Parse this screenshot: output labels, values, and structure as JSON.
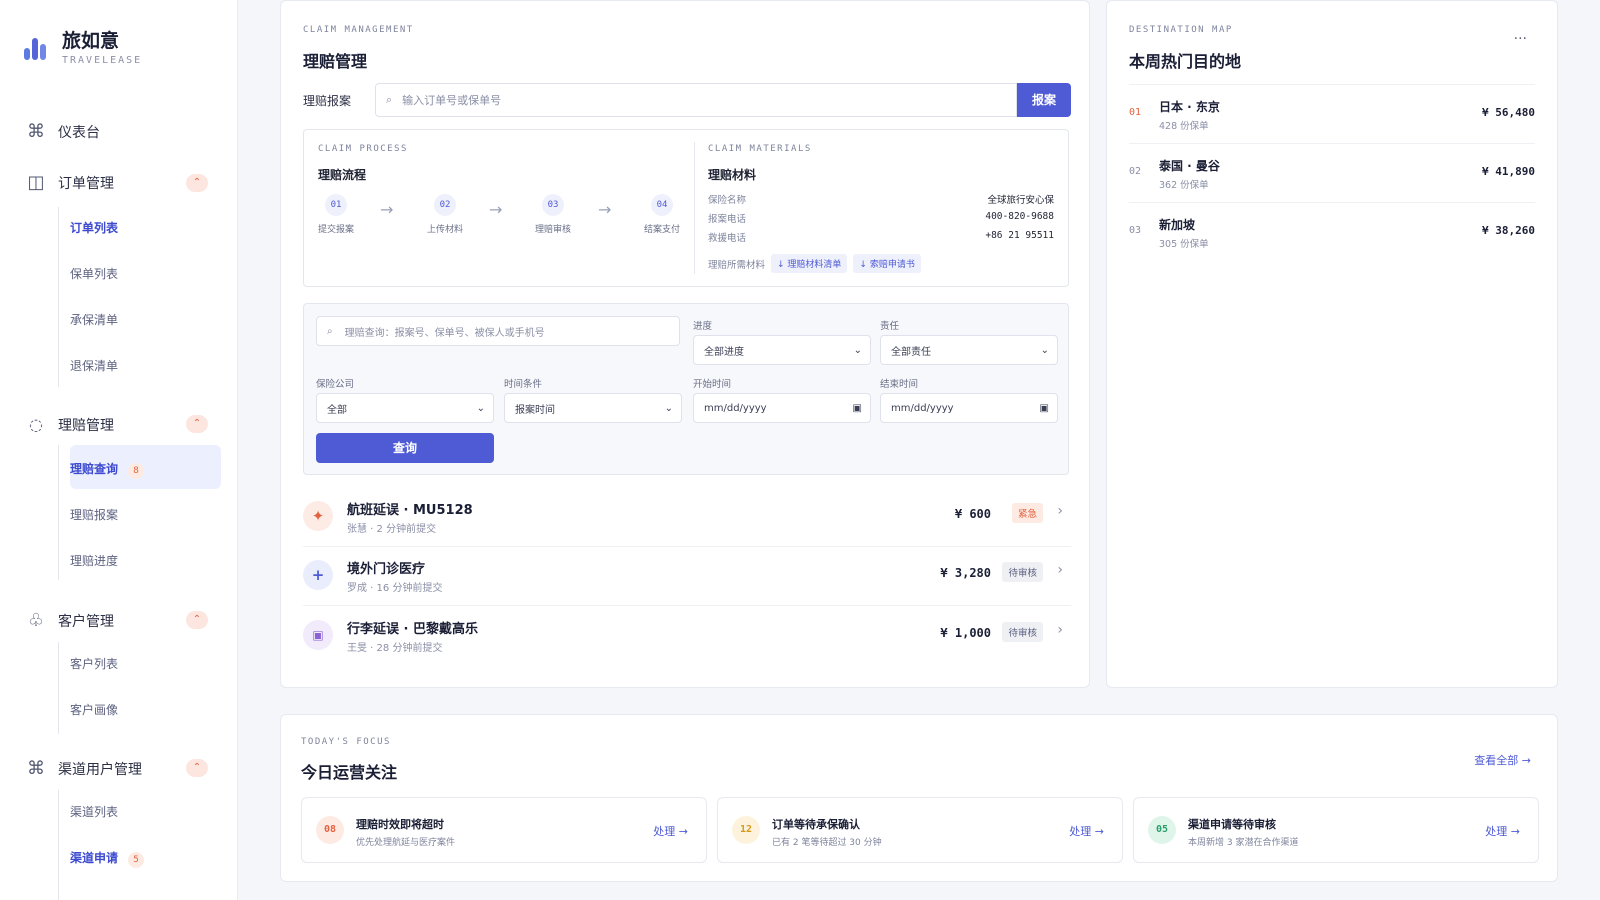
{
  "brand": {
    "name": "旅如意",
    "sub": "TRAVELEASE"
  },
  "nav": {
    "dashboard": "仪表台",
    "orders": {
      "label": "订单管理",
      "items": [
        "订单列表",
        "保单列表",
        "承保清单",
        "退保清单"
      ]
    },
    "claims": {
      "label": "理赔管理",
      "items": [
        "理赔查询",
        "理赔报案",
        "理赔进度"
      ],
      "badge": "8"
    },
    "customers": {
      "label": "客户管理",
      "items": [
        "客户列表",
        "客户画像"
      ]
    },
    "channels": {
      "label": "渠道用户管理",
      "items": [
        "渠道列表",
        "渠道申请"
      ],
      "badge": "5"
    }
  },
  "claim": {
    "eyebrow": "CLAIM MANAGEMENT",
    "title": "理赔管理",
    "report_label": "理赔报案",
    "report_placeholder": "输入订单号或保单号",
    "report_button": "报案",
    "process": {
      "eyebrow": "CLAIM PROCESS",
      "title": "理赔流程",
      "steps": [
        {
          "num": "01",
          "label": "提交报案"
        },
        {
          "num": "02",
          "label": "上传材料"
        },
        {
          "num": "03",
          "label": "理赔审核"
        },
        {
          "num": "04",
          "label": "结案支付"
        }
      ]
    },
    "materials": {
      "eyebrow": "CLAIM MATERIALS",
      "title": "理赔材料",
      "rows": [
        {
          "k": "保险名称",
          "v": "全球旅行安心保"
        },
        {
          "k": "报案电话",
          "v": "400-820-9688"
        },
        {
          "k": "救援电话",
          "v": "+86 21 95511"
        }
      ],
      "docs_label": "理赔所需材料",
      "docs": [
        "↓ 理赔材料清单",
        "↓ 索赔申请书"
      ]
    },
    "filters": {
      "query_placeholder": "理赔查询：报案号、保单号、被保人或手机号",
      "progress_label": "进度",
      "progress_value": "全部进度",
      "duty_label": "责任",
      "duty_value": "全部责任",
      "insurer_label": "保险公司",
      "insurer_value": "全部",
      "time_label": "时间条件",
      "time_value": "报案时间",
      "start_label": "开始时间",
      "start_value": "mm/dd/yyyy",
      "end_label": "结束时间",
      "end_value": "mm/dd/yyyy",
      "query_button": "查询"
    },
    "list": [
      {
        "title": "航班延误 · MU5128",
        "meta": "张慧 · 2 分钟前提交",
        "amount": "¥ 600",
        "tag": "紧急",
        "icon": "✦"
      },
      {
        "title": "境外门诊医疗",
        "meta": "罗成 · 16 分钟前提交",
        "amount": "¥ 3,280",
        "tag": "待审核",
        "icon": "+"
      },
      {
        "title": "行李延误 · 巴黎戴高乐",
        "meta": "王旻 · 28 分钟前提交",
        "amount": "¥ 1,000",
        "tag": "待审核",
        "icon": "▣"
      }
    ]
  },
  "destination": {
    "eyebrow": "DESTINATION MAP",
    "title": "本周热门目的地",
    "more": "···",
    "items": [
      {
        "idx": "01",
        "name": "日本 · 东京",
        "count": "428 份保单",
        "price": "¥ 56,480"
      },
      {
        "idx": "02",
        "name": "泰国 · 曼谷",
        "count": "362 份保单",
        "price": "¥ 41,890"
      },
      {
        "idx": "03",
        "name": "新加坡",
        "count": "305 份保单",
        "price": "¥ 38,260"
      }
    ]
  },
  "focus": {
    "eyebrow": "TODAY'S FOCUS",
    "title": "今日运营关注",
    "view_all": "查看全部 →",
    "cards": [
      {
        "num": "08",
        "title": "理赔时效即将超时",
        "sub": "优先处理航延与医疗案件",
        "action": "处理 →"
      },
      {
        "num": "12",
        "title": "订单等待承保确认",
        "sub": "已有 2 笔等待超过 30 分钟",
        "action": "处理 →"
      },
      {
        "num": "05",
        "title": "渠道申请等待审核",
        "sub": "本周新增 3 家潜在合作渠道",
        "action": "处理 →"
      }
    ]
  },
  "colors": {
    "accent": "#4f5bd5",
    "urgent": "#e4623f"
  }
}
